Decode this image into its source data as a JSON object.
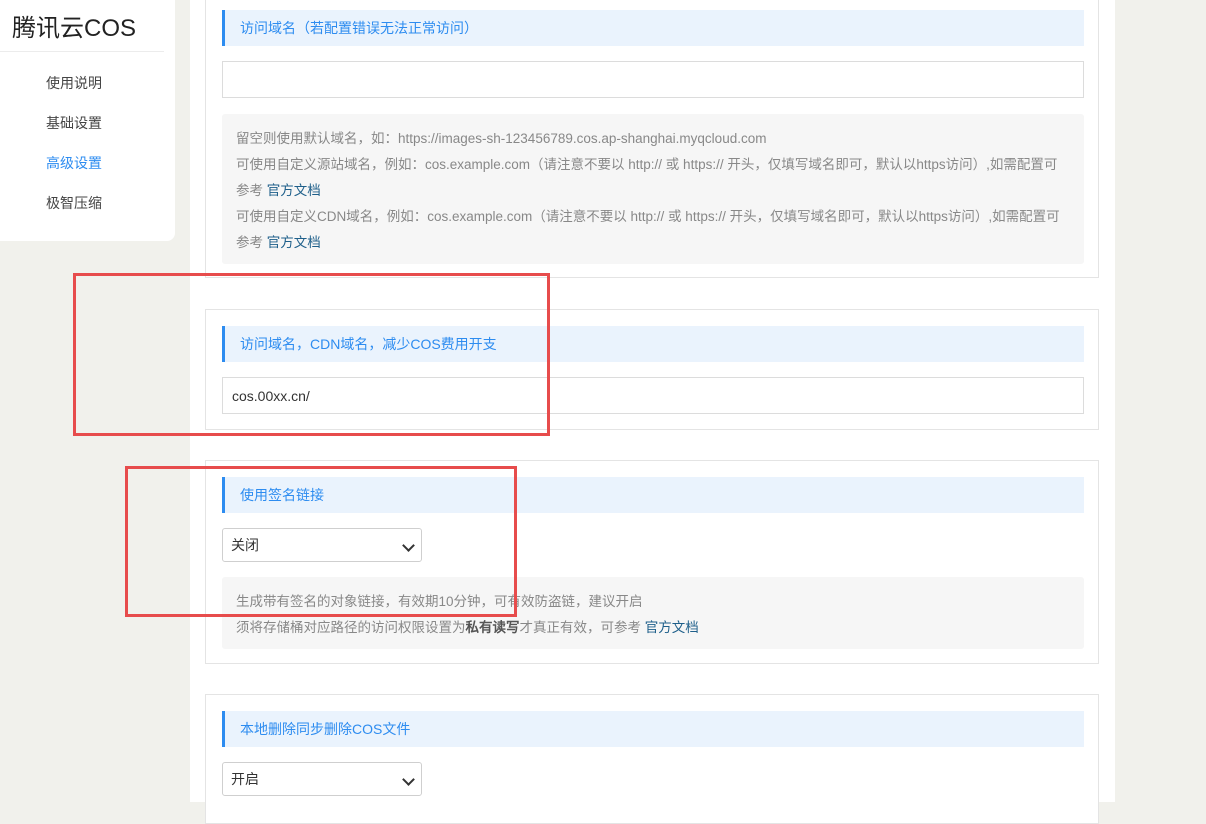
{
  "sidebar": {
    "brand": "腾讯云COS",
    "items": [
      {
        "label": "使用说明"
      },
      {
        "label": "基础设置"
      },
      {
        "label": "高级设置"
      },
      {
        "label": "极智压缩"
      }
    ]
  },
  "sections": {
    "origin": {
      "title": "访问域名（若配置错误无法正常访问）",
      "value": "",
      "hint": {
        "line1": "留空则使用默认域名，如：https://images-sh-123456789.cos.ap-shanghai.myqcloud.com",
        "line2": "可使用自定义源站域名，例如：cos.example.com（请注意不要以 http:// 或 https:// 开头，仅填写域名即可，默认以https访问）,如需配置可参考",
        "line3": "可使用自定义CDN域名，例如：cos.example.com（请注意不要以 http:// 或 https:// 开头，仅填写域名即可，默认以https访问）,如需配置可参考",
        "link": "官方文档"
      }
    },
    "cdn": {
      "title": "访问域名，CDN域名，减少COS费用开支",
      "value": "cos.00xx.cn/"
    },
    "signed": {
      "title": "使用签名链接",
      "selected": "关闭",
      "hint": {
        "line1": "生成带有签名的对象链接，有效期10分钟，可有效防盗链，建议开启",
        "line2_pre": "须将存储桶对应路径的访问权限设置为",
        "line2_bold": "私有读写",
        "line2_post": "才真正有效，可参考",
        "link": "官方文档"
      }
    },
    "delete_sync": {
      "title": "本地删除同步删除COS文件",
      "selected": "开启"
    }
  },
  "colors": {
    "accent": "#2d8cf0",
    "annotation": "#e74c4c",
    "background": "#f1f1ec"
  }
}
